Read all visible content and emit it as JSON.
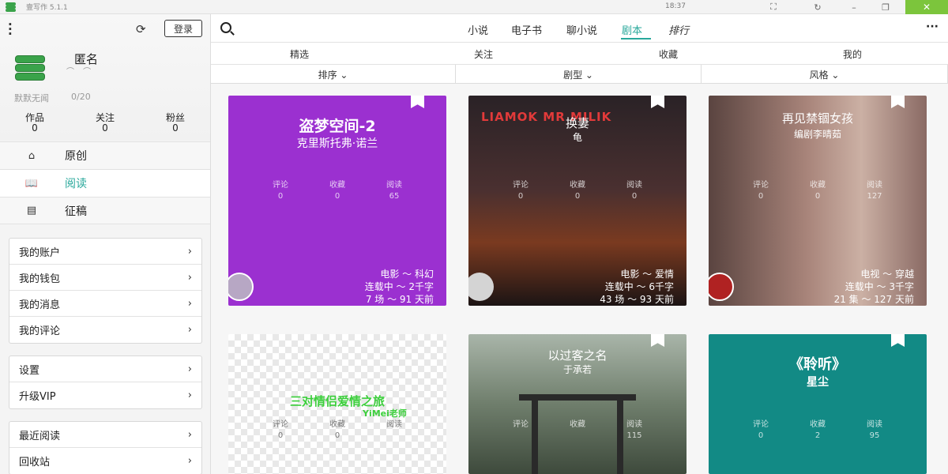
{
  "window": {
    "app_title": "壹写作 5.1.1",
    "clock": "18:37",
    "colors": {
      "accent": "#29a89b",
      "close": "#7cc53c"
    }
  },
  "sidebar": {
    "login_label": "登录",
    "user_name": "匿名",
    "motto": "默默无闻",
    "motto_count": "0/20",
    "stats": [
      {
        "label": "作品",
        "value": "0"
      },
      {
        "label": "关注",
        "value": "0"
      },
      {
        "label": "粉丝",
        "value": "0"
      }
    ],
    "nav": [
      {
        "label": "原创",
        "icon": "home-icon"
      },
      {
        "label": "阅读",
        "icon": "book-icon",
        "active": true
      },
      {
        "label": "征稿",
        "icon": "document-icon"
      }
    ],
    "group1": [
      "我的账户",
      "我的钱包",
      "我的消息",
      "我的评论"
    ],
    "group2": [
      "设置",
      "升级VIP"
    ],
    "group3": [
      "最近阅读",
      "回收站"
    ]
  },
  "main": {
    "categories": [
      "小说",
      "电子书",
      "聊小说",
      "剧本",
      "排行"
    ],
    "active_category": "剧本",
    "subtabs": [
      "精选",
      "关注",
      "收藏",
      "我的"
    ],
    "filters": [
      "排序 ⌄",
      "剧型 ⌄",
      "风格 ⌄"
    ],
    "stat_labels": [
      "评论",
      "收藏",
      "阅读"
    ],
    "cards": [
      {
        "title": "盗梦空间-2",
        "author": "克里斯托弗·诺兰",
        "comments": "0",
        "favorites": "0",
        "reads": "65",
        "genre": "电影 ～ 科幻",
        "progress": "连载中 ～ 2千字",
        "episodes": "7 场 ～ 91 天前",
        "color": "#9b30d0"
      },
      {
        "title": "换妻",
        "author": "龟",
        "comments": "0",
        "favorites": "0",
        "reads": "0",
        "genre": "电影 ～ 爱情",
        "progress": "连载中 ～ 6千字",
        "episodes": "43 场 ～ 93 天前",
        "cover_text": "LIAMOK MR MILIK",
        "color": "#3a2a2a"
      },
      {
        "title": "再见禁锢女孩",
        "author": "编剧李晴茹",
        "comments": "0",
        "favorites": "0",
        "reads": "127",
        "genre": "电视 ～ 穿越",
        "progress": "连载中 ～ 3千字",
        "episodes": "21 集 ～ 127 天前",
        "color": "#8a6a64"
      },
      {
        "title": "",
        "author": "",
        "comments": "0",
        "favorites": "0",
        "reads": "",
        "cover_text": "三对情侣爱情之旅",
        "cover_sub": "YiMei老师",
        "color": "#e8e4ea"
      },
      {
        "title": "以过客之名",
        "author": "于承若",
        "comments": "",
        "favorites": "",
        "reads": "115",
        "color": "#5d6a5c"
      },
      {
        "title": "《聆听》",
        "author": "星尘",
        "comments": "0",
        "favorites": "2",
        "reads": "95",
        "color": "#128a85"
      }
    ]
  }
}
